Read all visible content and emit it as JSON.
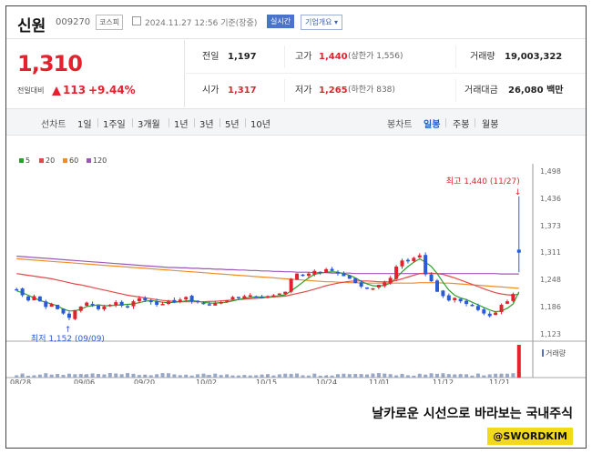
{
  "header": {
    "name": "신원",
    "code": "009270",
    "market": "코스피",
    "datetime": "2024.11.27 12:56 기준(장중)",
    "realtime_label": "실시간",
    "overview_label": "기업개요 ▾"
  },
  "price": {
    "current": "1,310",
    "change_label": "전일대비",
    "change": "113",
    "percent": "+9.44%"
  },
  "stats": {
    "prev_label": "전일",
    "prev": "1,197",
    "high_label": "고가",
    "high": "1,440",
    "high_limit": "(상한가 1,556)",
    "volume_label": "거래량",
    "volume": "19,003,322",
    "open_label": "시가",
    "open": "1,317",
    "low_label": "저가",
    "low": "1,265",
    "low_limit": "(하한가 838)",
    "amount_label": "거래대금",
    "amount": "26,080 백만"
  },
  "tabs": {
    "line": "선차트",
    "periods": [
      "1일",
      "1주일",
      "3개월",
      "1년",
      "3년",
      "5년",
      "10년"
    ],
    "candle": "봉차트",
    "candle_periods": [
      "일봉",
      "주봉",
      "월봉"
    ],
    "active_candle": "일봉"
  },
  "legend": [
    {
      "label": "5",
      "color": "#2ca02c"
    },
    {
      "label": "20",
      "color": "#e24a4a"
    },
    {
      "label": "60",
      "color": "#f08c2a"
    },
    {
      "label": "120",
      "color": "#9b59b6"
    }
  ],
  "chart_data": {
    "type": "candlestick",
    "y_ticks": [
      "1,498",
      "1,436",
      "1,373",
      "1,311",
      "1,248",
      "1,186",
      "1,123"
    ],
    "ylim": [
      1123,
      1498
    ],
    "x_labels": [
      "08/28",
      "09/06",
      "09/20",
      "10/02",
      "10/15",
      "10/24",
      "11/01",
      "11/12",
      "11/21"
    ],
    "high_annotation": "최고 1,440 (11/27)",
    "low_annotation": "최저 1,152 (09/09)",
    "volume_label": "거래량",
    "close": [
      1225,
      1212,
      1200,
      1210,
      1198,
      1185,
      1192,
      1180,
      1170,
      1160,
      1178,
      1186,
      1195,
      1190,
      1180,
      1186,
      1190,
      1196,
      1188,
      1185,
      1198,
      1205,
      1200,
      1196,
      1190,
      1192,
      1198,
      1195,
      1202,
      1208,
      1198,
      1196,
      1192,
      1190,
      1194,
      1196,
      1200,
      1208,
      1206,
      1210,
      1212,
      1208,
      1205,
      1210,
      1212,
      1216,
      1220,
      1250,
      1262,
      1258,
      1262,
      1268,
      1264,
      1272,
      1268,
      1262,
      1256,
      1250,
      1240,
      1232,
      1230,
      1228,
      1236,
      1242,
      1252,
      1278,
      1292,
      1290,
      1298,
      1304,
      1260,
      1244,
      1220,
      1210,
      1200,
      1206,
      1198,
      1192,
      1190,
      1178,
      1170,
      1164,
      1172,
      1190,
      1198,
      1215,
      1310
    ],
    "ma5": [
      1222,
      1218,
      1212,
      1206,
      1200,
      1196,
      1192,
      1188,
      1180,
      1176,
      1176,
      1180,
      1186,
      1188,
      1190,
      1188,
      1188,
      1189,
      1190,
      1191,
      1192,
      1195,
      1198,
      1200,
      1198,
      1196,
      1195,
      1196,
      1197,
      1199,
      1200,
      1198,
      1196,
      1194,
      1194,
      1195,
      1196,
      1199,
      1202,
      1205,
      1207,
      1208,
      1208,
      1208,
      1209,
      1211,
      1213,
      1222,
      1232,
      1242,
      1252,
      1260,
      1263,
      1265,
      1266,
      1265,
      1262,
      1258,
      1252,
      1244,
      1238,
      1234,
      1233,
      1235,
      1240,
      1252,
      1266,
      1278,
      1288,
      1296,
      1288,
      1278,
      1262,
      1242,
      1224,
      1212,
      1206,
      1202,
      1196,
      1190,
      1184,
      1178,
      1174,
      1176,
      1182,
      1192,
      1220
    ],
    "ma20": [
      1262,
      1260,
      1258,
      1256,
      1254,
      1252,
      1250,
      1247,
      1244,
      1241,
      1238,
      1236,
      1233,
      1230,
      1227,
      1224,
      1221,
      1218,
      1215,
      1212,
      1210,
      1208,
      1206,
      1204,
      1202,
      1200,
      1199,
      1198,
      1197,
      1197,
      1197,
      1197,
      1197,
      1198,
      1198,
      1199,
      1200,
      1201,
      1202,
      1203,
      1204,
      1205,
      1206,
      1207,
      1208,
      1209,
      1210,
      1213,
      1216,
      1219,
      1222,
      1226,
      1230,
      1234,
      1237,
      1240,
      1242,
      1244,
      1245,
      1245,
      1245,
      1244,
      1243,
      1243,
      1243,
      1246,
      1250,
      1254,
      1258,
      1262,
      1263,
      1263,
      1262,
      1260,
      1256,
      1252,
      1247,
      1242,
      1237,
      1232,
      1227,
      1222,
      1218,
      1215,
      1213,
      1212,
      1215
    ],
    "ma60": [
      1296,
      1295,
      1294,
      1293,
      1292,
      1291,
      1290,
      1289,
      1288,
      1287,
      1286,
      1285,
      1284,
      1283,
      1282,
      1281,
      1280,
      1279,
      1278,
      1277,
      1276,
      1275,
      1274,
      1273,
      1272,
      1271,
      1270,
      1269,
      1268,
      1267,
      1266,
      1265,
      1264,
      1263,
      1262,
      1261,
      1260,
      1259,
      1258,
      1257,
      1256,
      1255,
      1254,
      1253,
      1252,
      1251,
      1250,
      1249,
      1248,
      1247,
      1246,
      1245,
      1244,
      1243,
      1243,
      1242,
      1242,
      1241,
      1241,
      1240,
      1240,
      1240,
      1240,
      1240,
      1240,
      1240,
      1240,
      1240,
      1240,
      1241,
      1241,
      1241,
      1241,
      1240,
      1240,
      1239,
      1238,
      1237,
      1236,
      1235,
      1234,
      1233,
      1232,
      1231,
      1230,
      1229,
      1228
    ],
    "ma120": [
      1302,
      1301,
      1300,
      1299,
      1298,
      1297,
      1296,
      1295,
      1294,
      1293,
      1292,
      1291,
      1290,
      1289,
      1288,
      1287,
      1286,
      1285,
      1284,
      1283,
      1282,
      1281,
      1280,
      1279,
      1278,
      1277,
      1276,
      1276,
      1275,
      1275,
      1274,
      1274,
      1273,
      1273,
      1272,
      1272,
      1271,
      1271,
      1270,
      1270,
      1269,
      1269,
      1268,
      1268,
      1267,
      1267,
      1266,
      1266,
      1265,
      1265,
      1265,
      1264,
      1264,
      1264,
      1263,
      1263,
      1263,
      1263,
      1262,
      1262,
      1262,
      1262,
      1262,
      1262,
      1262,
      1262,
      1262,
      1262,
      1262,
      1262,
      1262,
      1262,
      1262,
      1262,
      1262,
      1262,
      1262,
      1262,
      1262,
      1262,
      1262,
      1262,
      1262,
      1261,
      1261,
      1261,
      1261
    ]
  },
  "footer": {
    "caption": "날카로운 시선으로 바라보는 국내주식",
    "badge": "@SWORDKIM"
  }
}
